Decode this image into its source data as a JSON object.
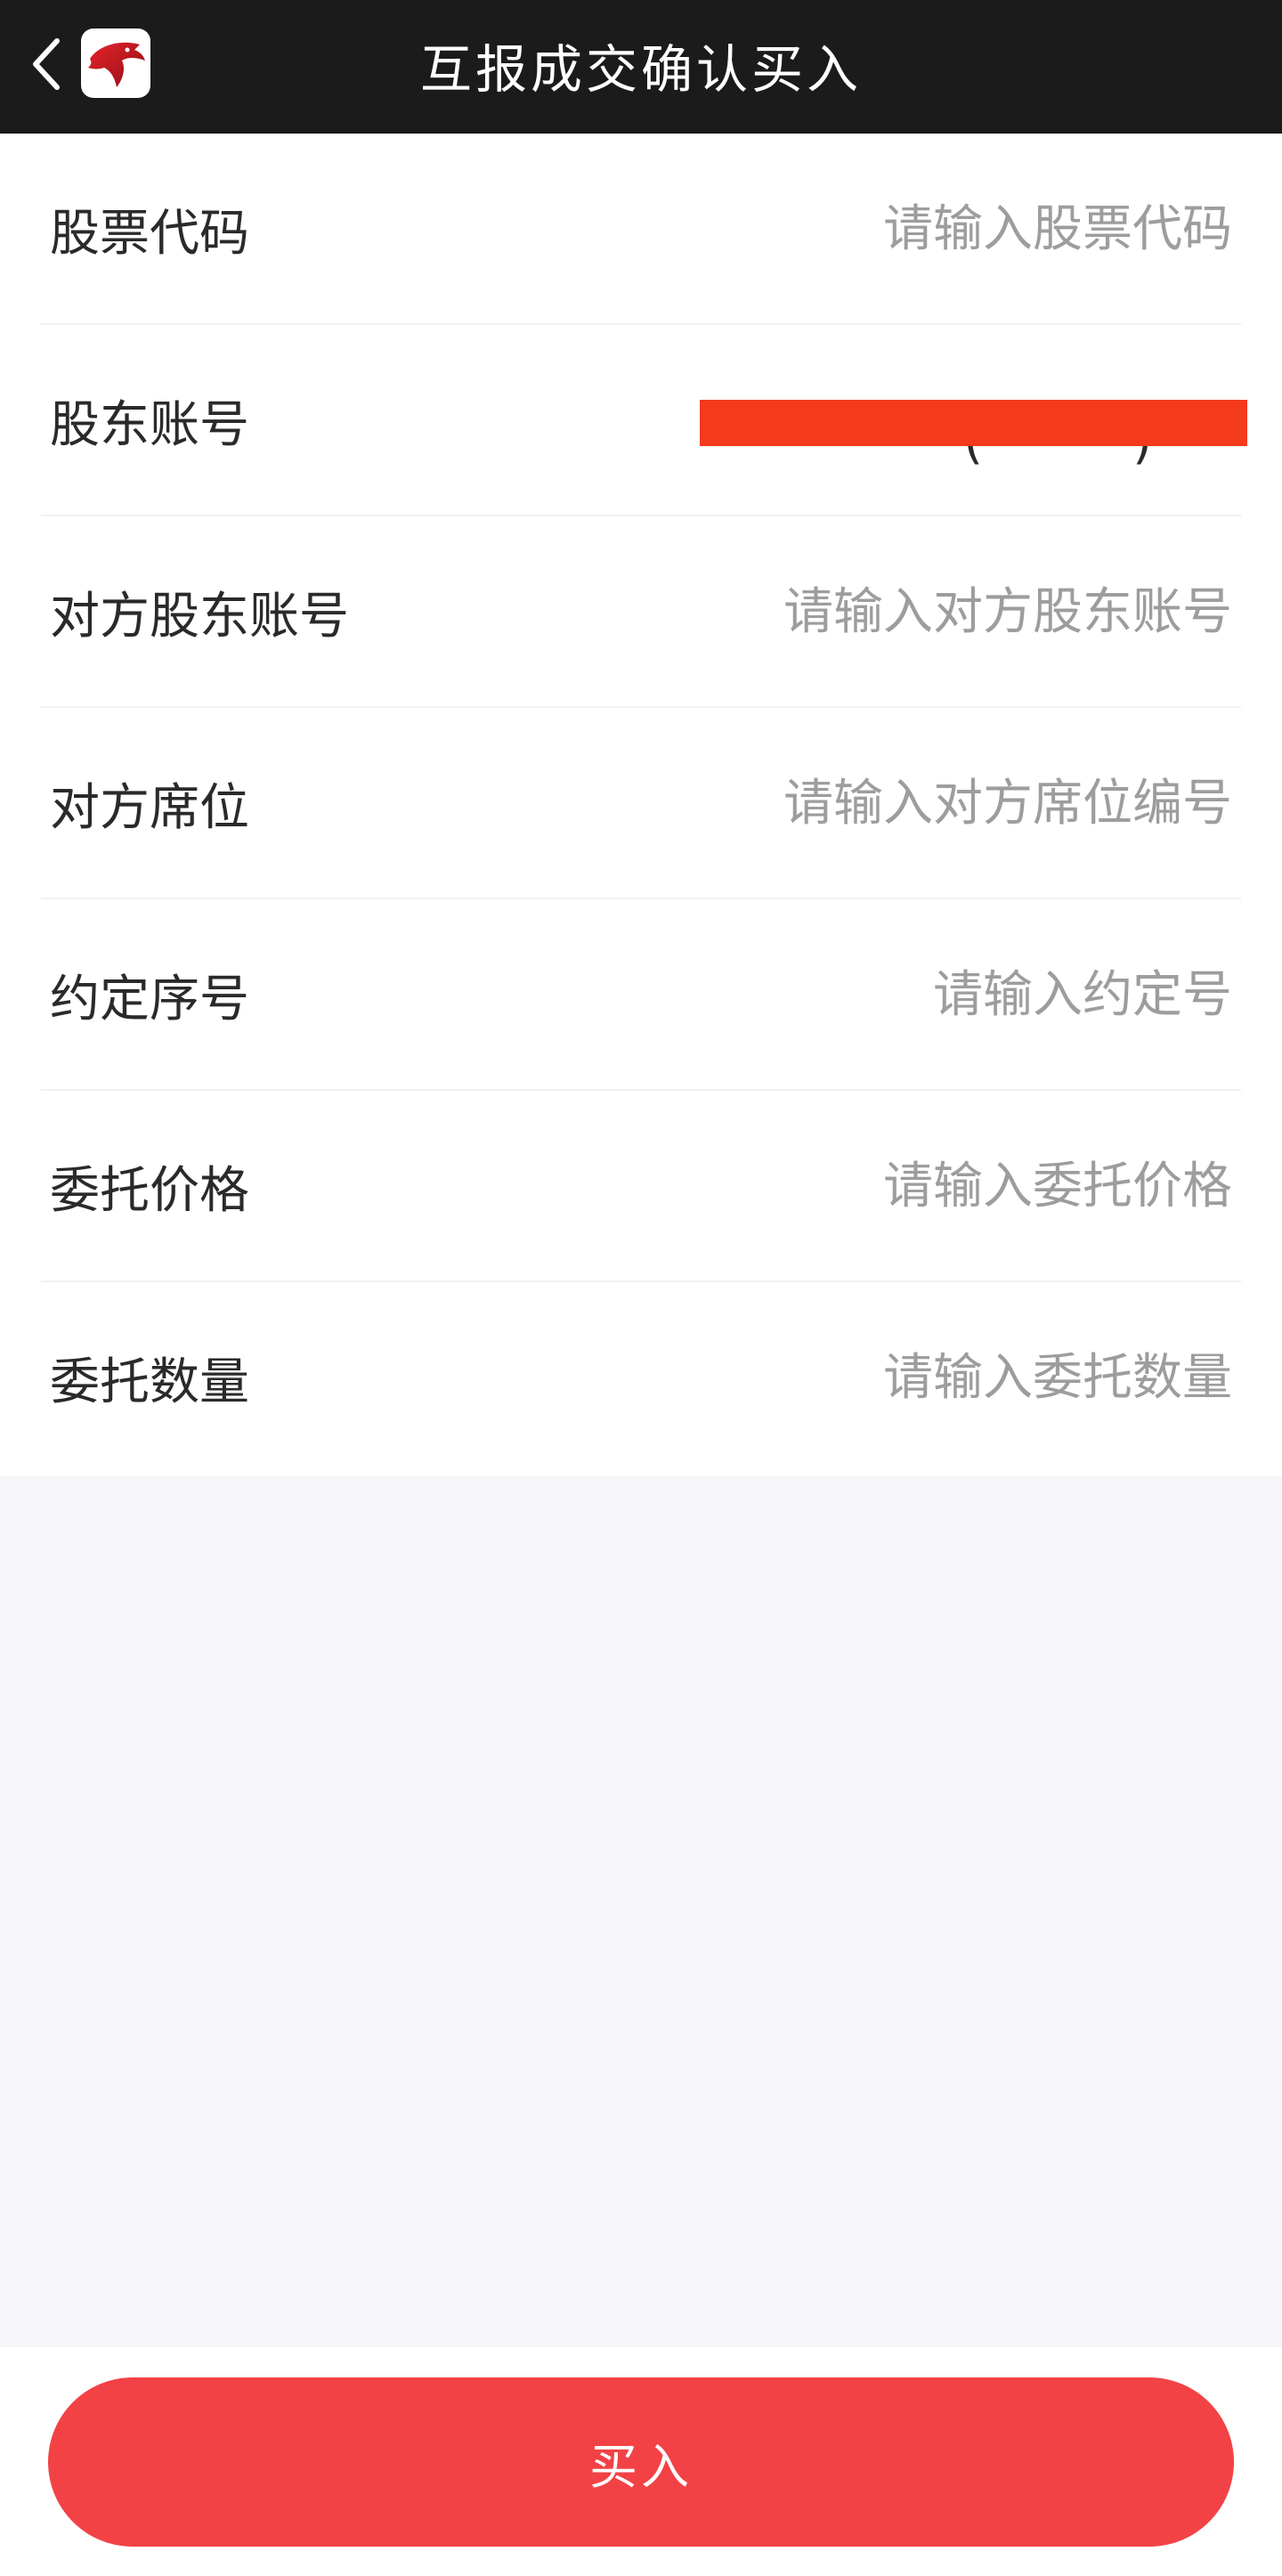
{
  "nav": {
    "title": "互报成交确认买入",
    "back_icon": "chevron-left-icon",
    "logo_icon": "dolphin-logo-icon"
  },
  "form": {
    "rows": [
      {
        "label": "股票代码",
        "placeholder": "请输入股票代码",
        "value": ""
      },
      {
        "label": "股东账号",
        "value": "(　　　)",
        "redacted": true
      },
      {
        "label": "对方股东账号",
        "placeholder": "请输入对方股东账号",
        "value": ""
      },
      {
        "label": "对方席位",
        "placeholder": "请输入对方席位编号",
        "value": ""
      },
      {
        "label": "约定序号",
        "placeholder": "请输入约定号",
        "value": ""
      },
      {
        "label": "委托价格",
        "placeholder": "请输入委托价格",
        "value": ""
      },
      {
        "label": "委托数量",
        "placeholder": "请输入委托数量",
        "value": ""
      }
    ]
  },
  "footer": {
    "buy_label": "买入"
  },
  "colors": {
    "nav_bg": "#1b1b1b",
    "accent": "#f24245",
    "redaction": "#f33a1c",
    "placeholder": "#9d9d9d",
    "page_bg": "#f7f7f9"
  }
}
